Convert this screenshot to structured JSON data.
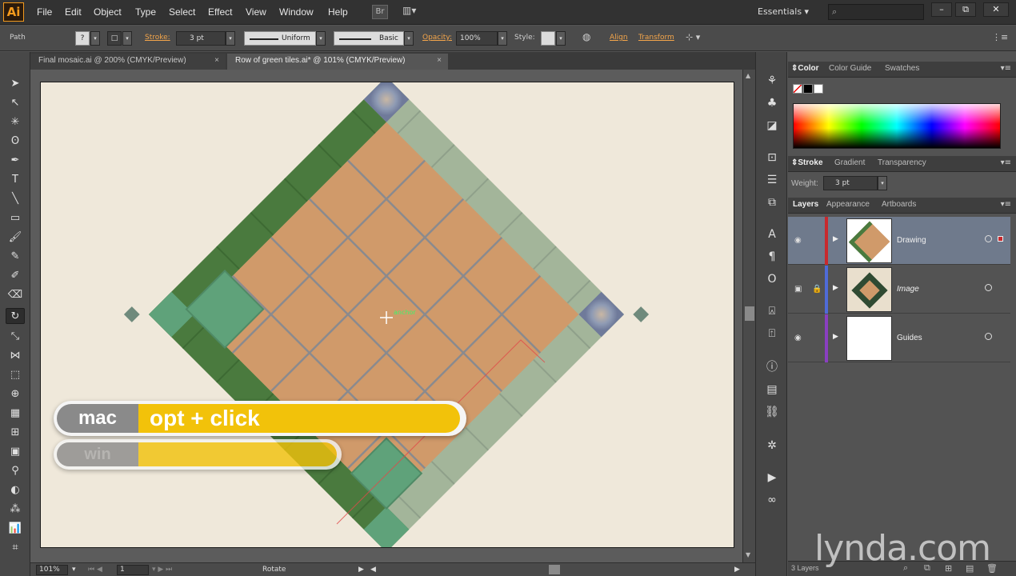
{
  "app": {
    "logo": "Ai"
  },
  "menu": [
    "File",
    "Edit",
    "Object",
    "Type",
    "Select",
    "Effect",
    "View",
    "Window",
    "Help"
  ],
  "workspace": "Essentials",
  "window_controls": [
    "–",
    "⧉",
    "✕"
  ],
  "control_bar": {
    "selection_type": "Path",
    "stroke_label": "Stroke:",
    "stroke_value": "3 pt",
    "profile": "Uniform",
    "brush": "Basic",
    "opacity_label": "Opacity:",
    "opacity_value": "100%",
    "style_label": "Style:",
    "align": "Align",
    "transform": "Transform"
  },
  "tabs": [
    {
      "label": "Final mosaic.ai @ 200% (CMYK/Preview)",
      "active": false
    },
    {
      "label": "Row of green tiles.ai* @ 101% (CMYK/Preview)",
      "active": true
    }
  ],
  "canvas": {
    "hint": "anchor"
  },
  "keyboard_overlay": {
    "mac_label": "mac",
    "mac_keys": "opt + click",
    "win_label": "win",
    "win_keys": ""
  },
  "status_bar": {
    "zoom": "101%",
    "artboard": "1",
    "tool": "Rotate"
  },
  "panels": {
    "color_tabs": [
      "Color",
      "Color Guide",
      "Swatches"
    ],
    "stroke_tabs": [
      "Stroke",
      "Gradient",
      "Transparency"
    ],
    "weight_label": "Weight:",
    "weight_value": "3 pt",
    "layers_tabs": [
      "Layers",
      "Appearance",
      "Artboards"
    ],
    "layers": [
      {
        "name": "Drawing",
        "color": "#c8292d",
        "selected": true
      },
      {
        "name": "Image",
        "color": "#4f6bd8",
        "selected": false
      },
      {
        "name": "Guides",
        "color": "#8a3fc0",
        "selected": false
      }
    ],
    "layers_count": "3 Layers"
  },
  "watermark": "lynda.com",
  "colors": {
    "terracotta": "#d09a6a",
    "grout": "#8a8a8e",
    "dark_green": "#4a7a3e",
    "sea_green": "#5fa27a",
    "sage": "#a3b59a",
    "parchment": "#efe8da",
    "overlay_yellow": "#f2c20a"
  }
}
